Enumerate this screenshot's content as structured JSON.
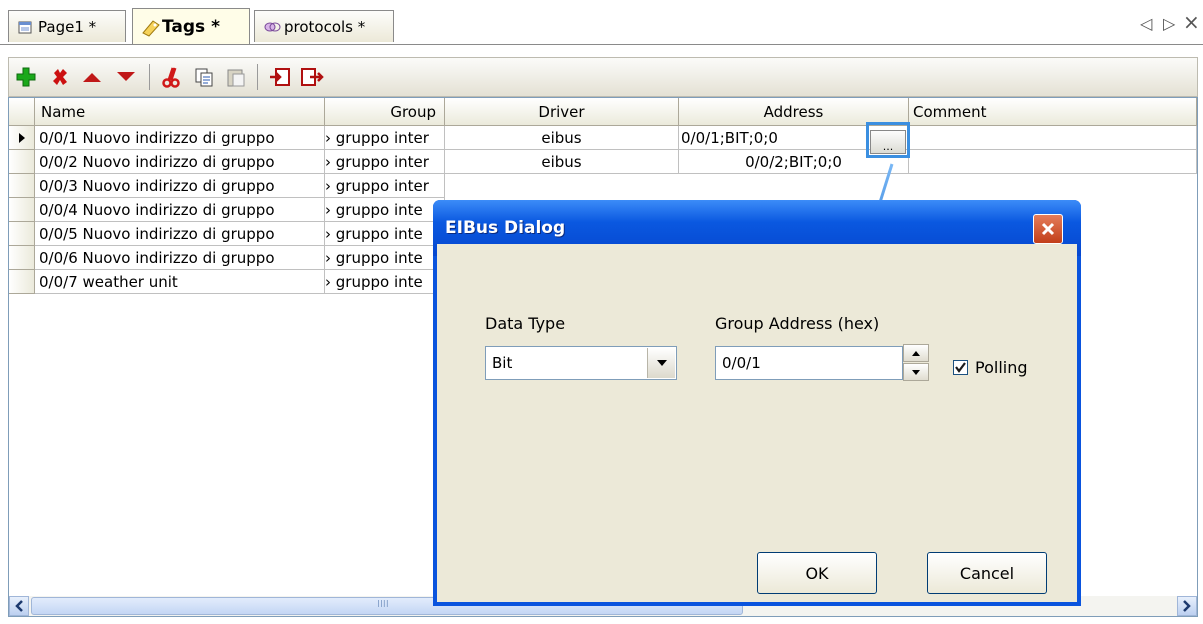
{
  "tabs": [
    {
      "label": "Page1 *",
      "icon": "page-icon"
    },
    {
      "label": "Tags *",
      "icon": "tags-icon"
    },
    {
      "label": "protocols *",
      "icon": "protocols-icon"
    }
  ],
  "nav": {
    "prev": "◁",
    "next": "▷",
    "close": "×"
  },
  "toolbar": {
    "icons": [
      "add-icon",
      "delete-icon",
      "move-up-icon",
      "move-down-icon",
      "cut-icon",
      "copy-icon",
      "paste-icon",
      "import-icon",
      "export-icon"
    ],
    "colors": {
      "add": "#1aa81a",
      "delete": "#cc1010",
      "arrow": "#c01818"
    }
  },
  "grid": {
    "columns": [
      "Name",
      "Group",
      "Driver",
      "Address",
      "Comment"
    ],
    "rows": [
      {
        "name": "0/0/1 Nuovo indirizzo di gruppo",
        "group": "› gruppo inter",
        "driver": "eibus",
        "address": "0/0/1;BIT;0;0"
      },
      {
        "name": "0/0/2 Nuovo indirizzo di gruppo",
        "group": "› gruppo inter",
        "driver": "eibus",
        "address": "0/0/2;BIT;0;0"
      },
      {
        "name": "0/0/3 Nuovo indirizzo di gruppo",
        "group": "› gruppo inter",
        "driver": "",
        "address": ""
      },
      {
        "name": "0/0/4 Nuovo indirizzo di gruppo",
        "group": "› gruppo inte",
        "driver": "",
        "address": ""
      },
      {
        "name": "0/0/5 Nuovo indirizzo di gruppo",
        "group": "› gruppo inte",
        "driver": "",
        "address": ""
      },
      {
        "name": "0/0/6 Nuovo indirizzo di gruppo",
        "group": "› gruppo inte",
        "driver": "",
        "address": ""
      },
      {
        "name": "0/0/7 weather unit",
        "group": "› gruppo inte",
        "driver": "",
        "address": ""
      }
    ],
    "ellipsis_label": "..."
  },
  "dialog": {
    "title": "EIBus Dialog",
    "data_type_label": "Data Type",
    "data_type_value": "Bit",
    "group_address_label": "Group Address (hex)",
    "group_address_value": "0/0/1",
    "polling_label": "Polling",
    "polling_checked": true,
    "ok_label": "OK",
    "cancel_label": "Cancel",
    "title_color": "#0a58e0",
    "body_color": "#ece9d8"
  },
  "scrollbar": {
    "grip": "IIII"
  }
}
